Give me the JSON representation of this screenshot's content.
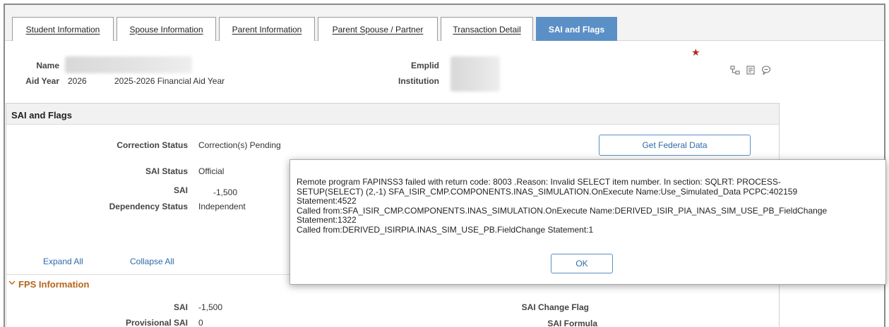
{
  "tabs": [
    {
      "label": "Student Information",
      "active": false
    },
    {
      "label": "Spouse Information",
      "active": false
    },
    {
      "label": "Parent Information",
      "active": false
    },
    {
      "label": "Parent Spouse / Partner",
      "active": false
    },
    {
      "label": "Transaction Detail",
      "active": false
    },
    {
      "label": "SAI and Flags",
      "active": true
    }
  ],
  "header": {
    "name_label": "Name",
    "aid_year_label": "Aid Year",
    "aid_year_value": "2026",
    "aid_year_desc": "2025-2026 Financial Aid Year",
    "emplid_label": "Emplid",
    "institution_label": "Institution",
    "required_mark": "★"
  },
  "section": {
    "title": "SAI and Flags",
    "correction_status_label": "Correction Status",
    "correction_status_value": "Correction(s) Pending",
    "sai_status_label": "SAI Status",
    "sai_status_value": "Official",
    "sai_label": "SAI",
    "sai_value": "-1,500",
    "dependency_status_label": "Dependency Status",
    "dependency_status_value": "Independent",
    "get_federal_data_label": "Get Federal Data",
    "expand_all_label": "Expand All",
    "collapse_all_label": "Collapse All"
  },
  "fps": {
    "title": "FPS Information",
    "sai_label": "SAI",
    "sai_value": "-1,500",
    "provisional_sai_label": "Provisional SAI",
    "provisional_sai_value": "0",
    "sai_change_flag_label": "SAI Change Flag",
    "sai_formula_label": "SAI Formula"
  },
  "modal": {
    "message": "Remote program FAPINSS3 failed  with return code: 8003 .Reason: Invalid SELECT item number.  In section: SQLRT: PROCESS-\nSETUP(SELECT) (2,-1) SFA_ISIR_CMP.COMPONENTS.INAS_SIMULATION.OnExecute  Name:Use_Simulated_Data  PCPC:402159\nStatement:4522\nCalled from:SFA_ISIR_CMP.COMPONENTS.INAS_SIMULATION.OnExecute  Name:DERIVED_ISIR_PIA_INAS_SIM_USE_PB_FieldChange\nStatement:1322\nCalled from:DERIVED_ISIRPIA.INAS_SIM_USE_PB.FieldChange  Statement:1",
    "ok_label": "OK"
  },
  "icons": {
    "accent": "#5b90c7",
    "link": "#2f6aa8",
    "section_accent": "#b5651d"
  }
}
